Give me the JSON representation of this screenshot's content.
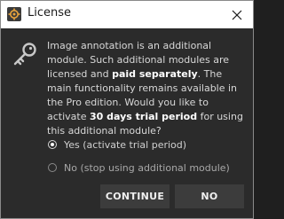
{
  "window": {
    "title": "License",
    "app_icon": "gear-icon",
    "close_icon": "close-icon"
  },
  "message": {
    "part1": "Image annotation is an additional module. Such additional modules are licensed and ",
    "bold1": "paid separately",
    "part2": ". The main functionality remains available in the Pro edition. Would you like to activate ",
    "bold2": "30 days trial period",
    "part3": " for using this additional module?"
  },
  "options": [
    {
      "label": "Yes (activate trial period)",
      "selected": true
    },
    {
      "label": "No (stop using additional module)",
      "selected": false
    }
  ],
  "buttons": {
    "continue_label": "CONTINUE",
    "no_label": "NO"
  },
  "colors": {
    "background": "#2b2b2b",
    "titlebar": "#ffffff",
    "button": "#3c3c3c",
    "text": "#d8d8d8"
  }
}
